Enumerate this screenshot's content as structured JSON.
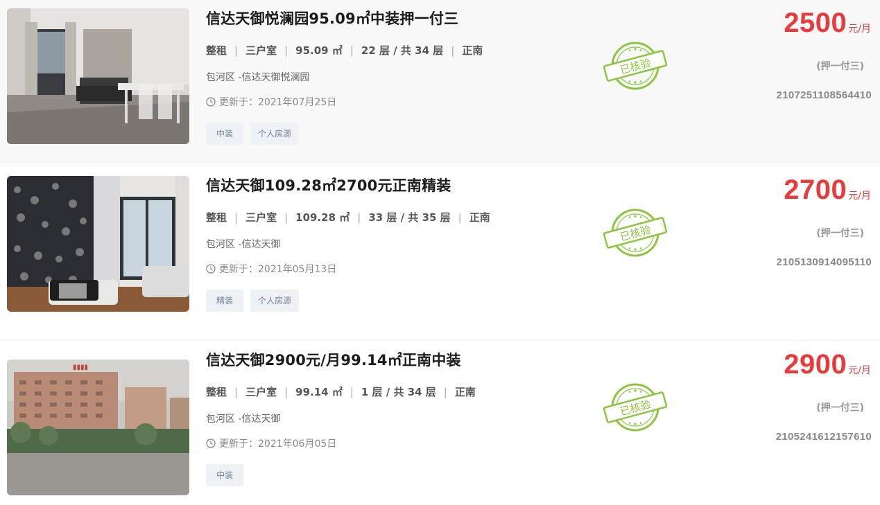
{
  "colors": {
    "price": "#e83c3c",
    "stamp": "#8cc63f",
    "tag_bg": "#eef2f6",
    "tag_text": "#6d8196"
  },
  "listings": [
    {
      "title": "信达天御悦澜园95.09㎡中装押一付三",
      "rent_type": "整租",
      "layout": "三户室",
      "area": "95.09 ㎡",
      "floor": "22 层 / 共 34 层",
      "orientation": "正南",
      "address": "包河区 -信达天御悦澜园",
      "updated": "更新于：2021年07月25日",
      "tags": [
        "中装",
        "个人房源"
      ],
      "stamp": "已核验",
      "price": "2500",
      "price_unit": "元/月",
      "payment": "(押一付三)",
      "code": "2107251108564410",
      "photo": "living-room-with-dining-table"
    },
    {
      "title": "信达天御109.28㎡2700元正南精装",
      "rent_type": "整租",
      "layout": "三户室",
      "area": "109.28 ㎡",
      "floor": "33 层 / 共 35 层",
      "orientation": "正南",
      "address": "包河区 -信达天御",
      "updated": "更新于：2021年05月13日",
      "tags": [
        "精装",
        "个人房源"
      ],
      "stamp": "已核验",
      "price": "2700",
      "price_unit": "元/月",
      "payment": "(押一付三)",
      "code": "2105130914095110",
      "photo": "living-room-with-floral-wallpaper"
    },
    {
      "title": "信达天御2900元/月99.14㎡正南中装",
      "rent_type": "整租",
      "layout": "三户室",
      "area": "99.14 ㎡",
      "floor": "1 层 / 共 34 层",
      "orientation": "正南",
      "address": "包河区 -信达天御",
      "updated": "更新于：2021年06月05日",
      "tags": [
        "中装"
      ],
      "stamp": "已核验",
      "price": "2900",
      "price_unit": "元/月",
      "payment": "(押一付三)",
      "code": "2105241612157610",
      "photo": "apartment-building-exterior"
    }
  ]
}
